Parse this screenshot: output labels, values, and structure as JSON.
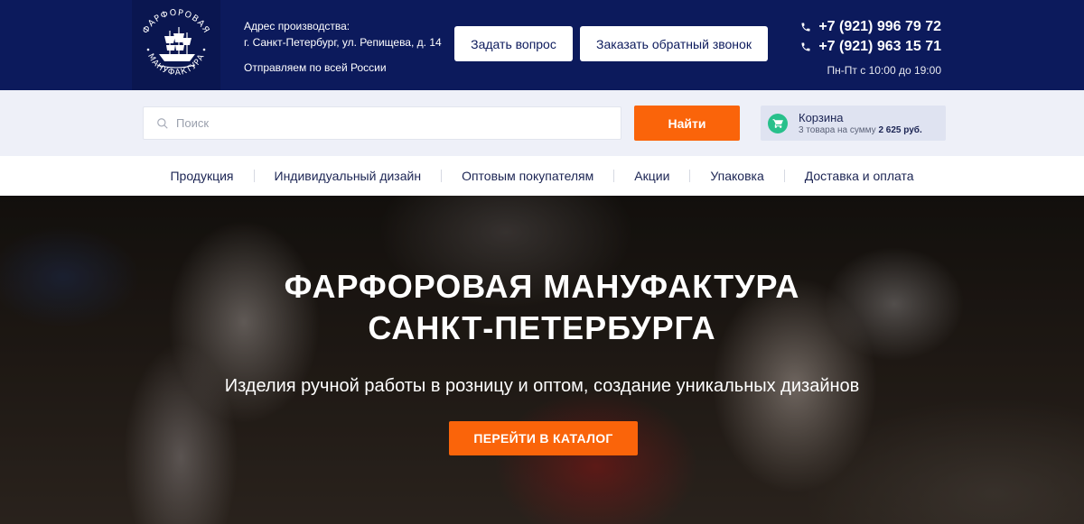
{
  "brand": {
    "logo_text": "ФАРФОРОВАЯ МАНУФАКТУРА"
  },
  "header": {
    "address_label": "Адрес производства:",
    "address_value": "г. Санкт-Петербург, ул. Репищева, д. 14",
    "shipping": "Отправляем по всей России",
    "ask_button": "Задать вопрос",
    "callback_button": "Заказать обратный звонок",
    "phones": [
      "+7 (921) 996 79 72",
      "+7 (921) 963 15 71"
    ],
    "hours": "Пн-Пт с 10:00 до 19:00"
  },
  "search": {
    "placeholder": "Поиск",
    "button": "Найти"
  },
  "cart": {
    "title": "Корзина",
    "summary_prefix": "3 товара на сумму",
    "summary_amount": "2 625 руб."
  },
  "nav": {
    "items": [
      "Продукция",
      "Индивидуальный дизайн",
      "Оптовым покупателям",
      "Акции",
      "Упаковка",
      "Доставка и оплата"
    ]
  },
  "hero": {
    "title_line1": "ФАРФОРОВАЯ МАНУФАКТУРА",
    "title_line2": "САНКТ-ПЕТЕРБУРГА",
    "subtitle": "Изделия ручной работы в розницу и оптом, создание уникальных дизайнов",
    "cta": "ПЕРЕЙТИ В КАТАЛОГ"
  },
  "colors": {
    "header_bg": "#0c1a5c",
    "accent": "#fa640a",
    "cart_icon": "#27c08b"
  }
}
